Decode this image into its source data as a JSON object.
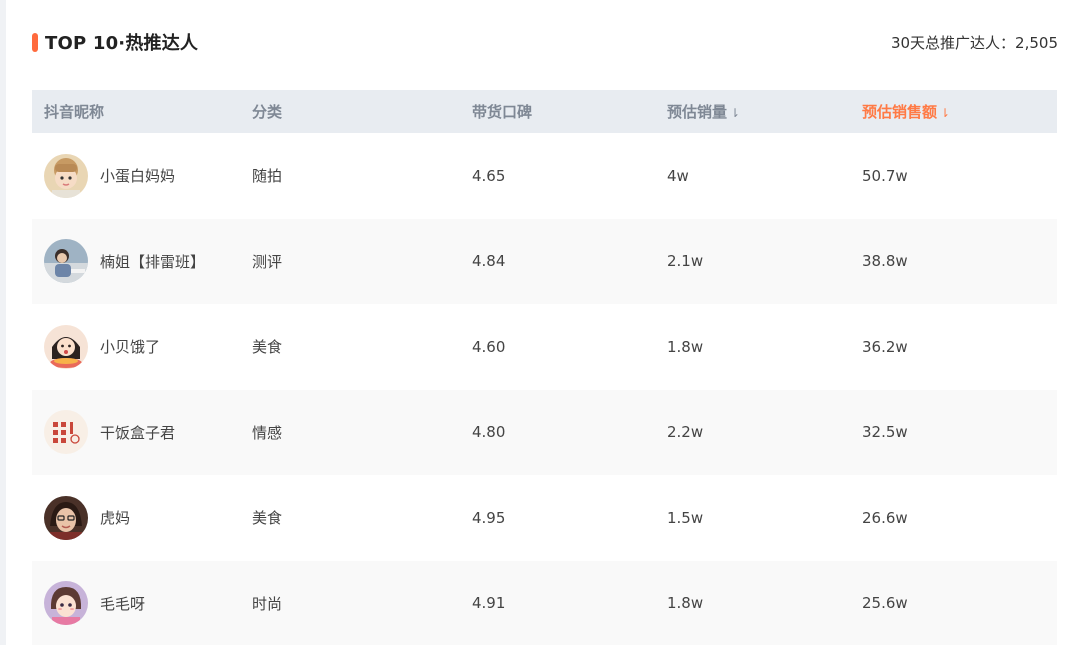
{
  "header": {
    "title": "TOP 10·热推达人",
    "summary": "30天总推广达人：2,505"
  },
  "table": {
    "columns": {
      "name": "抖音昵称",
      "category": "分类",
      "rating": "带货口碑",
      "sales": "预估销量",
      "gmv": "预估销售额"
    },
    "sort_icon": "down-arrow-icon",
    "active_sort_color": "#ff7a45",
    "rows": [
      {
        "avatar": "avatar-girl-icon",
        "name": "小蛋白妈妈",
        "category": "随拍",
        "rating": "4.65",
        "sales": "4w",
        "gmv": "50.7w"
      },
      {
        "avatar": "avatar-person-icon",
        "name": "楠姐【排雷班】",
        "category": "测评",
        "rating": "4.84",
        "sales": "2.1w",
        "gmv": "38.8w"
      },
      {
        "avatar": "avatar-cartoon-icon",
        "name": "小贝饿了",
        "category": "美食",
        "rating": "4.60",
        "sales": "1.8w",
        "gmv": "36.2w"
      },
      {
        "avatar": "avatar-seal-icon",
        "name": "干饭盒子君",
        "category": "情感",
        "rating": "4.80",
        "sales": "2.2w",
        "gmv": "32.5w"
      },
      {
        "avatar": "avatar-woman-icon",
        "name": "虎妈",
        "category": "美食",
        "rating": "4.95",
        "sales": "1.5w",
        "gmv": "26.6w"
      },
      {
        "avatar": "avatar-anime-icon",
        "name": "毛毛呀",
        "category": "时尚",
        "rating": "4.91",
        "sales": "1.8w",
        "gmv": "25.6w"
      }
    ]
  }
}
